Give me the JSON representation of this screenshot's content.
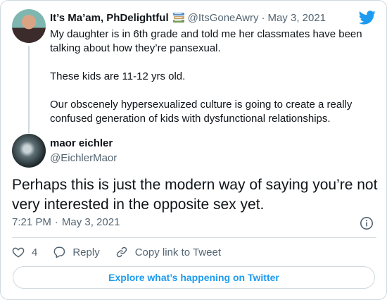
{
  "parent_tweet": {
    "author_name": "It’s Ma’am, PhDelightful",
    "handle": "@ItsGoneAwry",
    "separator": "·",
    "date": "May 3, 2021",
    "paragraphs": [
      "My daughter is in 6th grade and told me her classmates have been talking about how they’re pansexual.",
      "These kids are 11-12 yrs old.",
      "Our obscenely hypersexualized culture is going to create a really confused generation of kids with dysfunctional relationships."
    ]
  },
  "reply_tweet": {
    "author_name": "maor eichler",
    "handle": "@EichlerMaor",
    "text": "Perhaps this is just the modern way of saying you’re not very interested in the opposite sex yet.",
    "time": "7:21 PM",
    "separator": "·",
    "date": "May 3, 2021"
  },
  "actions": {
    "like_count": "4",
    "reply_label": "Reply",
    "copy_link_label": "Copy link to Tweet"
  },
  "explore_button_label": "Explore what’s happening on Twitter",
  "colors": {
    "brand_blue": "#1d9bf0",
    "muted_text": "#536471",
    "border": "#cfd9de"
  },
  "icons": [
    "twitter-bird-icon",
    "books-emoji-icon",
    "info-icon",
    "heart-icon",
    "reply-bubble-icon",
    "link-icon"
  ]
}
